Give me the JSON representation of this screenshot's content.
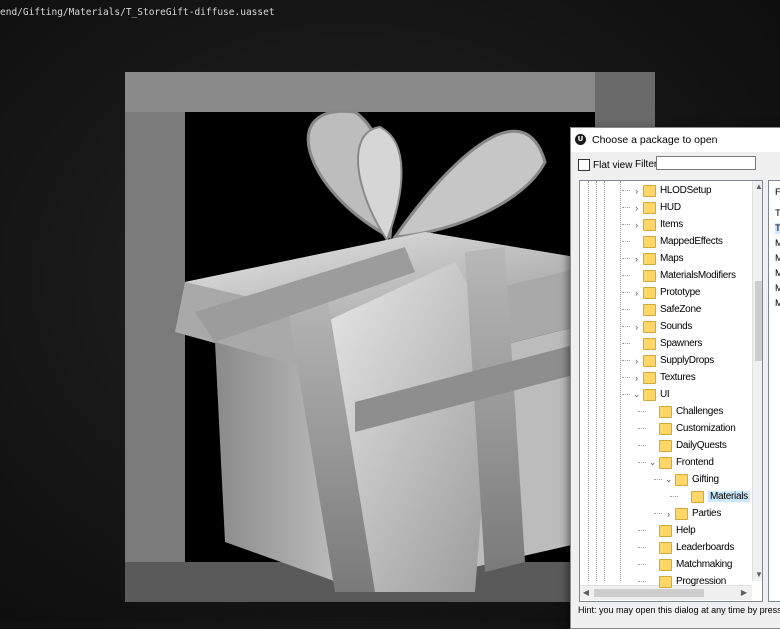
{
  "asset_path": "end/Gifting/Materials/T_StoreGift-diffuse.uasset",
  "dialog": {
    "title": "Choose a package to open",
    "flat_view_label": "Flat view",
    "filter_label": "Filter:",
    "filter_value": "",
    "hint": "Hint: you may open this dialog at any time by pressi",
    "tree": [
      {
        "label": "HLODSetup",
        "depth": 0,
        "expander": "collapsed",
        "selected": false
      },
      {
        "label": "HUD",
        "depth": 0,
        "expander": "collapsed",
        "selected": false
      },
      {
        "label": "Items",
        "depth": 0,
        "expander": "collapsed",
        "selected": false
      },
      {
        "label": "MappedEffects",
        "depth": 0,
        "expander": "none",
        "selected": false
      },
      {
        "label": "Maps",
        "depth": 0,
        "expander": "collapsed",
        "selected": false
      },
      {
        "label": "MaterialsModifiers",
        "depth": 0,
        "expander": "none",
        "selected": false
      },
      {
        "label": "Prototype",
        "depth": 0,
        "expander": "collapsed",
        "selected": false
      },
      {
        "label": "SafeZone",
        "depth": 0,
        "expander": "none",
        "selected": false
      },
      {
        "label": "Sounds",
        "depth": 0,
        "expander": "collapsed",
        "selected": false
      },
      {
        "label": "Spawners",
        "depth": 0,
        "expander": "none",
        "selected": false
      },
      {
        "label": "SupplyDrops",
        "depth": 0,
        "expander": "collapsed",
        "selected": false
      },
      {
        "label": "Textures",
        "depth": 0,
        "expander": "collapsed",
        "selected": false
      },
      {
        "label": "UI",
        "depth": 0,
        "expander": "expanded",
        "selected": false
      },
      {
        "label": "Challenges",
        "depth": 1,
        "expander": "none",
        "selected": false
      },
      {
        "label": "Customization",
        "depth": 1,
        "expander": "none",
        "selected": false
      },
      {
        "label": "DailyQuests",
        "depth": 1,
        "expander": "none",
        "selected": false
      },
      {
        "label": "Frontend",
        "depth": 1,
        "expander": "expanded",
        "selected": false
      },
      {
        "label": "Gifting",
        "depth": 2,
        "expander": "expanded",
        "selected": false
      },
      {
        "label": "Materials",
        "depth": 3,
        "expander": "none",
        "selected": true
      },
      {
        "label": "Parties",
        "depth": 2,
        "expander": "collapsed",
        "selected": false
      },
      {
        "label": "Help",
        "depth": 1,
        "expander": "none",
        "selected": false
      },
      {
        "label": "Leaderboards",
        "depth": 1,
        "expander": "none",
        "selected": false
      },
      {
        "label": "Matchmaking",
        "depth": 1,
        "expander": "none",
        "selected": false
      },
      {
        "label": "Progression",
        "depth": 1,
        "expander": "none",
        "selected": false
      }
    ],
    "right_panel": [
      "F",
      "T",
      "T",
      "M",
      "M",
      "M",
      "M",
      "M"
    ]
  }
}
